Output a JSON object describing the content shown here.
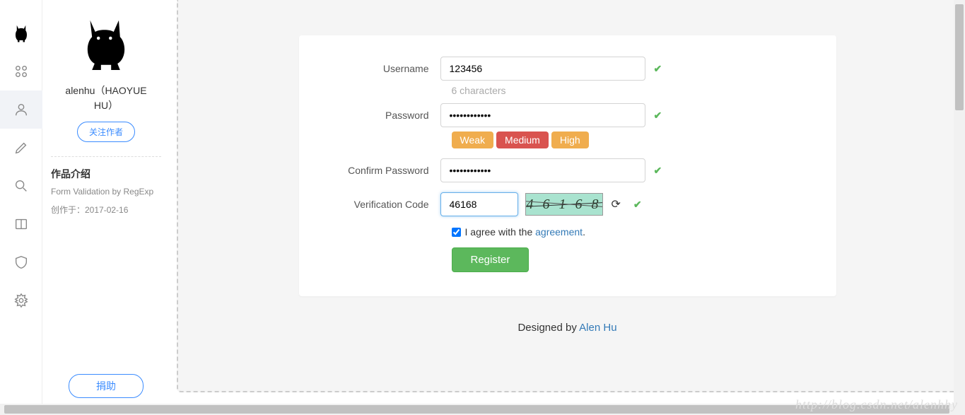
{
  "profile": {
    "author_name_l1": "alenhu（HAOYUE",
    "author_name_l2": "HU）",
    "follow_label": "关注作者",
    "intro_title": "作品介绍",
    "intro_desc": "Form Validation by RegExp",
    "created": "创作于：2017-02-16",
    "donate_label": "捐助"
  },
  "form": {
    "username": {
      "label": "Username",
      "value": "123456",
      "help": "6 characters"
    },
    "password": {
      "label": "Password",
      "value": "••••••••••••",
      "strength": {
        "weak": "Weak",
        "medium": "Medium",
        "high": "High"
      }
    },
    "confirm": {
      "label": "Confirm Password",
      "value": "••••••••••••"
    },
    "verification": {
      "label": "Verification Code",
      "value": "46168",
      "captcha_display": "4 6 1 6 8"
    },
    "agree": {
      "prefix": "I agree with the ",
      "link": "agreement",
      "suffix": "."
    },
    "register_label": "Register"
  },
  "footer": {
    "designed_prefix": "Designed by ",
    "designer": "Alen Hu"
  },
  "watermark": "http://blog.csdn.net/alenhhy"
}
